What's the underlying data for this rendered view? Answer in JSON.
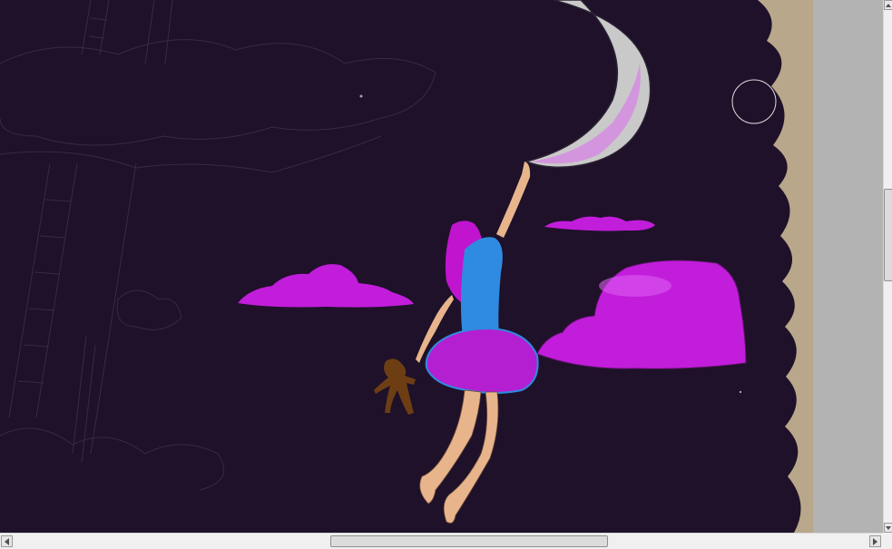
{
  "canvas": {
    "background_color": "#1e1129",
    "paper_color": "#b8a78a",
    "outer_gray": "#b3b3b3",
    "cloud_color": "#c21ddb",
    "moon_color": "#c9c9c9",
    "dress_colors": [
      "#2f8be0",
      "#b41fd1"
    ],
    "hair_color": "#c114cf",
    "skin_color": "#e8b48c",
    "bear_color": "#6d3e14"
  },
  "cursor": {
    "icon": "circle-brush-cursor-icon"
  },
  "scrollbars": {
    "horizontal": {
      "left_icon": "arrow-left-icon",
      "right_icon": "arrow-right-icon"
    },
    "vertical": {
      "up_icon": "arrow-up-icon",
      "down_icon": "arrow-down-icon"
    }
  }
}
